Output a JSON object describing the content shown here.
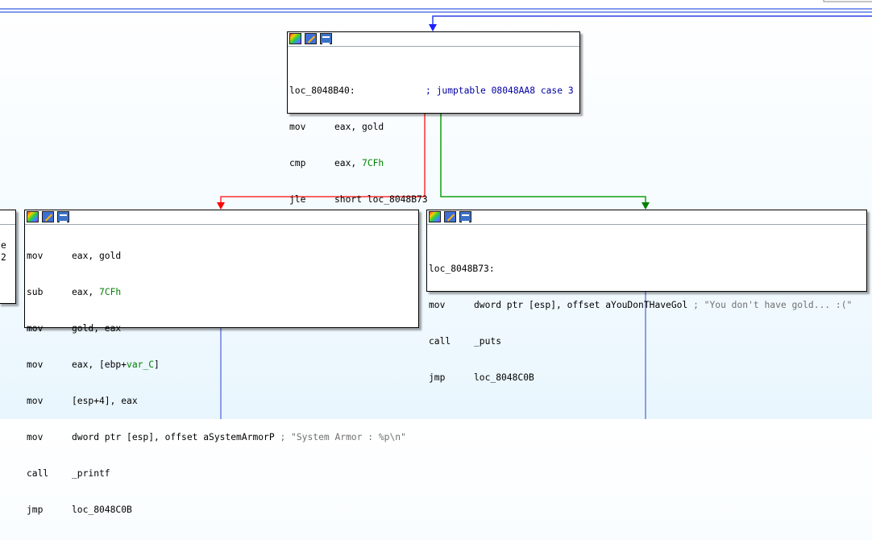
{
  "nodes": {
    "top": {
      "label": "loc_8048B40:",
      "comment": "; jumptable 08048AA8 case 3",
      "lines": [
        {
          "mn": "mov",
          "op": "eax, gold"
        },
        {
          "mn": "cmp",
          "op_pre": "eax, ",
          "op_num": "7CFh"
        },
        {
          "mn": "jle",
          "op": "short loc_8048B73"
        }
      ]
    },
    "left": {
      "lines": [
        {
          "mn": "mov",
          "op": "eax, gold"
        },
        {
          "mn": "sub",
          "op_pre": "eax, ",
          "op_num": "7CFh"
        },
        {
          "mn": "mov",
          "op": "gold, eax"
        },
        {
          "mn": "mov",
          "op_pre": "eax, [ebp+",
          "op_var": "var_C",
          "op_post": "]"
        },
        {
          "mn": "mov",
          "op": "[esp+4], eax"
        },
        {
          "mn": "mov",
          "op": "dword ptr [esp], offset aSystemArmorP",
          "cmt": " ; \"System Armor : %p\\n\""
        },
        {
          "mn": "call",
          "op": "_printf"
        },
        {
          "mn": "jmp",
          "op": "loc_8048C0B"
        }
      ]
    },
    "right": {
      "label": "loc_8048B73:",
      "lines": [
        {
          "mn": "mov",
          "op": "dword ptr [esp], offset aYouDonTHaveGol",
          "cmt": " ; \"You don't have gold... :(\""
        },
        {
          "mn": "call",
          "op": "_puts"
        },
        {
          "mn": "jmp",
          "op": "loc_8048C0B"
        }
      ]
    },
    "partial": {
      "text": "e 2"
    }
  },
  "colors": {
    "edge_true": "#ff0000",
    "edge_false": "#008000",
    "edge_uncond": "#0000ff"
  },
  "icons": [
    "color-palette-icon",
    "edit-pencil-icon",
    "graph-view-icon"
  ]
}
